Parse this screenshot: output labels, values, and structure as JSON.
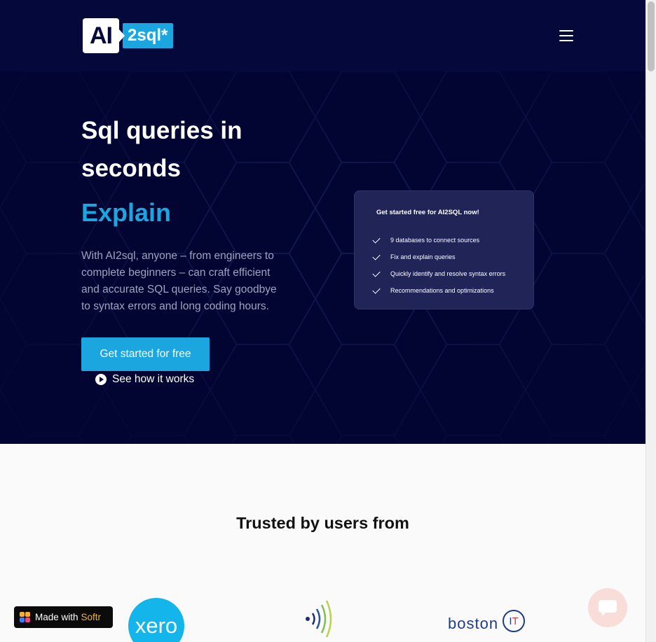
{
  "nav": {
    "logo_left": "AI",
    "logo_right": "2sql*",
    "menu_icon": "hamburger-icon"
  },
  "hero": {
    "title": "Sql queries in seconds",
    "accent": "Explain",
    "description": "With AI2sql, anyone – from engineers to complete beginners – can craft efficient and accurate SQL queries. Say goodbye to syntax errors and long coding hours.",
    "cta_label": "Get started for free",
    "how_label": "See how it works",
    "how_icon": "play-icon",
    "colors": {
      "background": "#020532",
      "accent": "#1ba6e0",
      "nav": "#05083b"
    }
  },
  "card": {
    "title": "Get started free for AI2SQL now!",
    "items": [
      "9 databases to connect sources",
      "Fix and explain queries",
      "Quickly identify and resolve syntax errors",
      "Recommendations and optimizations"
    ],
    "item_icon": "check-icon"
  },
  "trusted": {
    "title": "Trusted by users from",
    "logos": [
      "xero",
      "boston",
      "I",
      "T"
    ]
  },
  "softr": {
    "prefix": "Made with",
    "brand": "Softr"
  },
  "chat": {
    "icon": "chat-icon"
  }
}
